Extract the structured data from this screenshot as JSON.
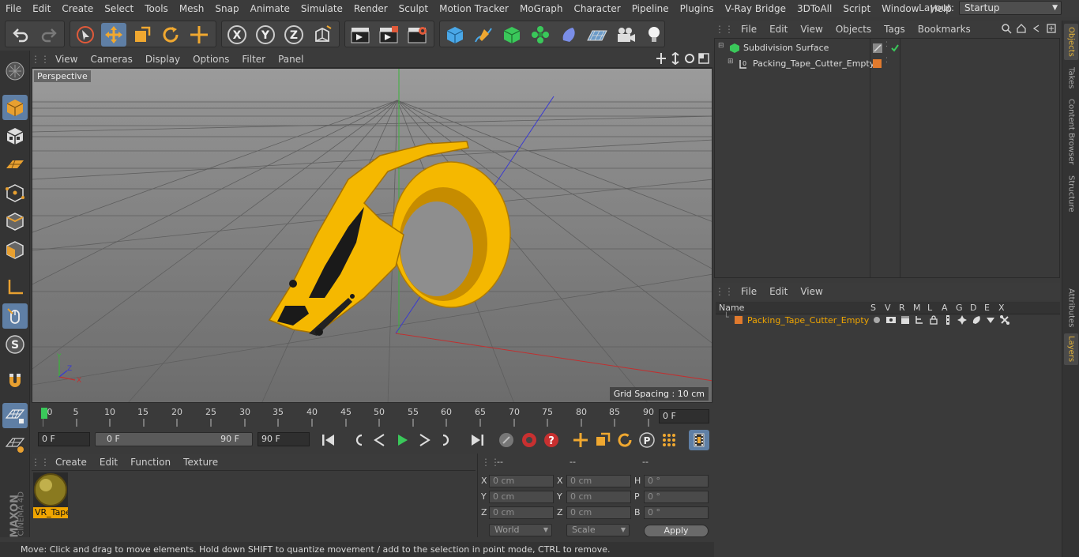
{
  "menubar": {
    "items": [
      "File",
      "Edit",
      "Create",
      "Select",
      "Tools",
      "Mesh",
      "Snap",
      "Animate",
      "Simulate",
      "Render",
      "Sculpt",
      "Motion Tracker",
      "MoGraph",
      "Character",
      "Pipeline",
      "Plugins",
      "V-Ray Bridge",
      "3DToAll",
      "Script",
      "Window",
      "Help"
    ],
    "layout_label": "Layout:",
    "layout_value": "Startup"
  },
  "viewport": {
    "menu": [
      "View",
      "Cameras",
      "Display",
      "Options",
      "Filter",
      "Panel"
    ],
    "label": "Perspective",
    "grid_spacing": "Grid Spacing : 10 cm"
  },
  "timeline": {
    "ticks": [
      "0",
      "5",
      "10",
      "15",
      "20",
      "25",
      "30",
      "35",
      "40",
      "45",
      "50",
      "55",
      "60",
      "65",
      "70",
      "75",
      "80",
      "85",
      "90"
    ],
    "current_frame": "0 F"
  },
  "transport": {
    "start_field": "0 F",
    "range_start": "0 F",
    "range_end": "90 F",
    "end_field": "90 F"
  },
  "material_manager": {
    "menu": [
      "Create",
      "Edit",
      "Function",
      "Texture"
    ],
    "material_name": "VR_Tape"
  },
  "coordinates": {
    "headers": [
      "--",
      "--",
      "--"
    ],
    "rows": [
      {
        "l1": "X",
        "v1": "0 cm",
        "l2": "X",
        "v2": "0 cm",
        "l3": "H",
        "v3": "0 °"
      },
      {
        "l1": "Y",
        "v1": "0 cm",
        "l2": "Y",
        "v2": "0 cm",
        "l3": "P",
        "v3": "0 °"
      },
      {
        "l1": "Z",
        "v1": "0 cm",
        "l2": "Z",
        "v2": "0 cm",
        "l3": "B",
        "v3": "0 °"
      }
    ],
    "space": "World",
    "mode": "Scale",
    "apply_label": "Apply"
  },
  "status_text": "Move: Click and drag to move elements. Hold down SHIFT to quantize movement / add to the selection in point mode, CTRL to remove.",
  "object_manager": {
    "menu": [
      "File",
      "Edit",
      "View",
      "Objects",
      "Tags",
      "Bookmarks"
    ],
    "objects": [
      {
        "name": "Subdivision Surface"
      },
      {
        "name": "Packing_Tape_Cutter_Empty"
      }
    ]
  },
  "layer_manager": {
    "menu": [
      "File",
      "Edit",
      "View"
    ],
    "columns": [
      "Name",
      "S",
      "V",
      "R",
      "M",
      "L",
      "A",
      "G",
      "D",
      "E",
      "X"
    ],
    "layers": [
      {
        "name": "Packing_Tape_Cutter_Empty"
      }
    ]
  },
  "side_tabs": [
    "Objects",
    "Takes",
    "Content Browser",
    "Structure",
    "Attributes",
    "Layers"
  ],
  "brand": {
    "line1": "MAXON",
    "line2": "CINEMA 4D"
  },
  "colors": {
    "accent": "#5f7fa5",
    "layer_orange": "#e07a2e",
    "highlight_text": "#f0a500",
    "object_yellow": "#f5b800"
  }
}
